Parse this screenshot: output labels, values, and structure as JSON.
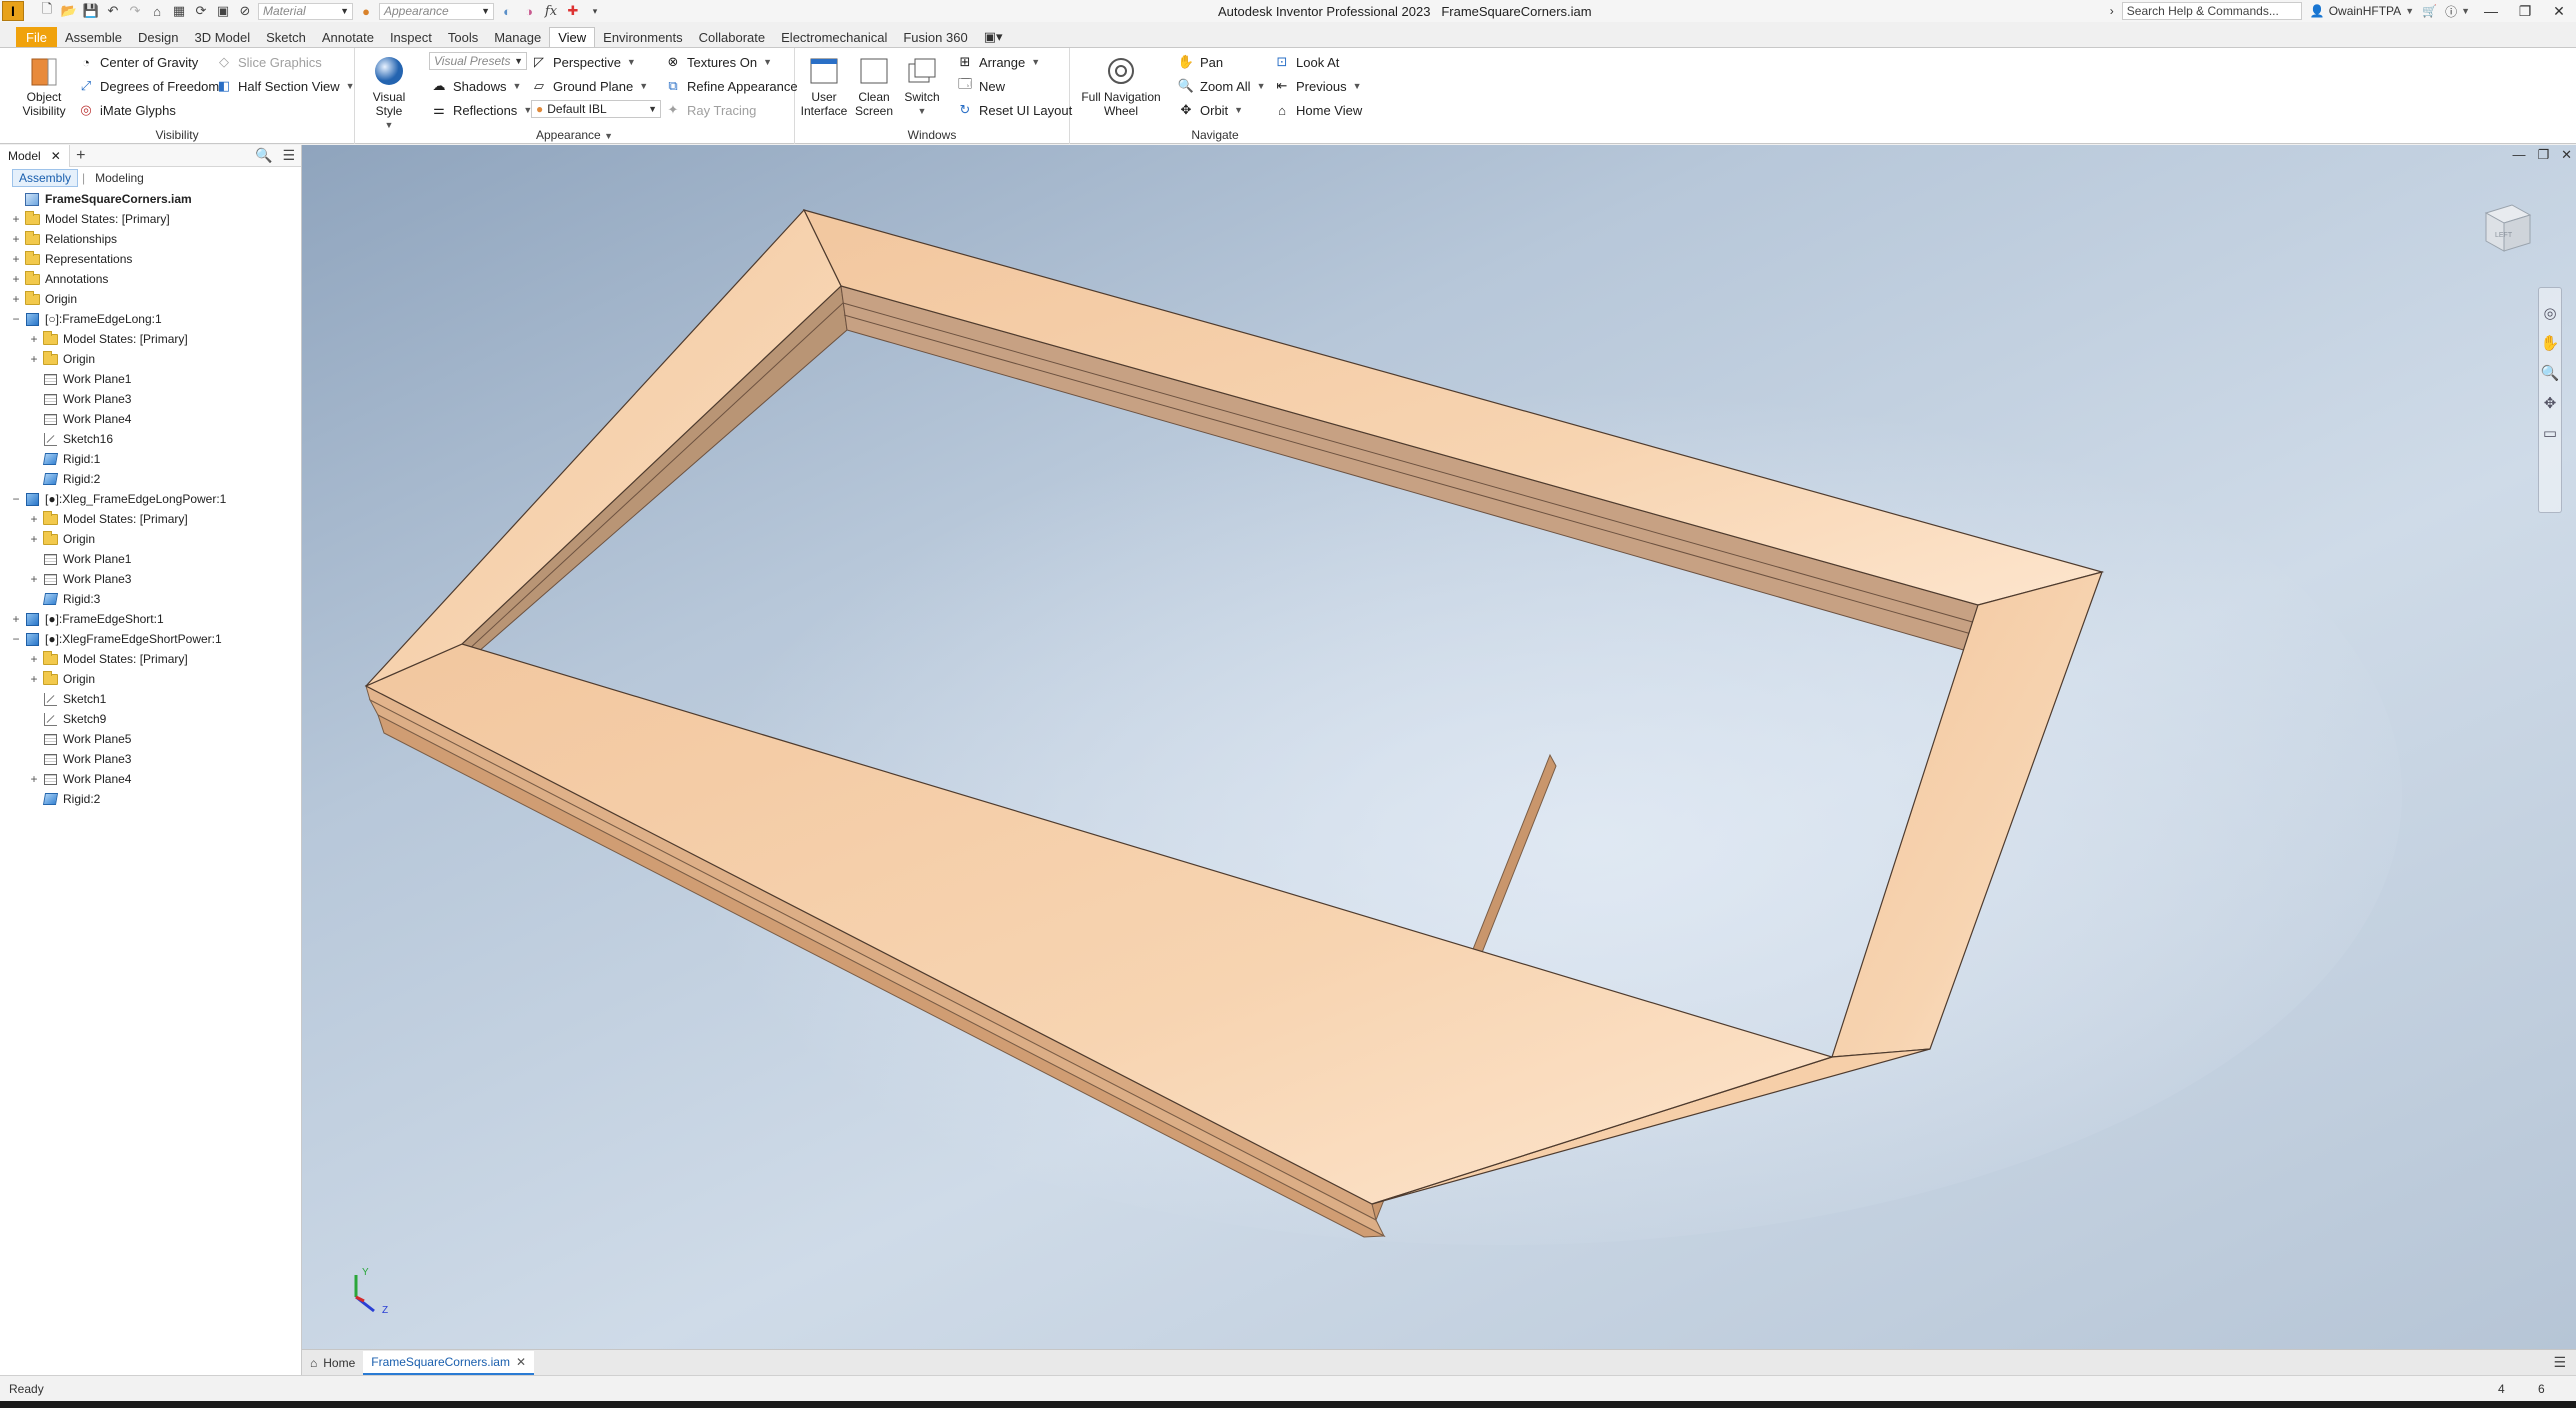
{
  "window": {
    "app_title": "Autodesk Inventor Professional 2023",
    "file_name": "FrameSquareCorners.iam",
    "logo_letter": "I"
  },
  "quick_access": {
    "material_placeholder": "Material",
    "appearance_placeholder": "Appearance",
    "fx_label": "fx"
  },
  "title_right": {
    "search_placeholder": "Search Help & Commands...",
    "user_name": "OwainHFTPA"
  },
  "menu_tabs": [
    "File",
    "Assemble",
    "Design",
    "3D Model",
    "Sketch",
    "Annotate",
    "Inspect",
    "Tools",
    "Manage",
    "View",
    "Environments",
    "Collaborate",
    "Electromechanical",
    "Fusion 360"
  ],
  "active_tab": "View",
  "ribbon": {
    "visibility": {
      "title": "Visibility",
      "object_visibility": "Object\nVisibility",
      "center_of_gravity": "Center of Gravity",
      "degrees_of_freedom": "Degrees of Freedom",
      "imate_glyphs": "iMate Glyphs",
      "slice_graphics": "Slice Graphics",
      "half_section_view": "Half Section View"
    },
    "appearance": {
      "title": "Appearance",
      "visual_style": "Visual Style",
      "visual_presets": "Visual Presets",
      "shadows": "Shadows",
      "reflections": "Reflections",
      "perspective": "Perspective",
      "ground_plane": "Ground Plane",
      "ibl_value": "Default IBL",
      "textures_on": "Textures On",
      "refine_appearance": "Refine Appearance",
      "ray_tracing": "Ray Tracing"
    },
    "windows": {
      "title": "Windows",
      "user_interface": "User\nInterface",
      "clean_screen": "Clean\nScreen",
      "switch": "Switch",
      "arrange": "Arrange",
      "new": "New",
      "reset_ui_layout": "Reset UI Layout"
    },
    "navigate": {
      "title": "Navigate",
      "full_navigation_wheel": "Full Navigation\nWheel",
      "pan": "Pan",
      "zoom_all": "Zoom All",
      "orbit": "Orbit",
      "look_at": "Look At",
      "previous": "Previous",
      "home_view": "Home View"
    }
  },
  "browser": {
    "tab_label": "Model",
    "subtabs": [
      "Assembly",
      "Modeling"
    ],
    "tree": [
      {
        "label": "FrameSquareCorners.iam",
        "level": 0,
        "icon": "assembly",
        "exp": "",
        "bold": true
      },
      {
        "label": "Model States: [Primary]",
        "level": 0,
        "icon": "folder",
        "exp": "+"
      },
      {
        "label": "Relationships",
        "level": 0,
        "icon": "folder",
        "exp": "+"
      },
      {
        "label": "Representations",
        "level": 0,
        "icon": "folder",
        "exp": "+"
      },
      {
        "label": "Annotations",
        "level": 0,
        "icon": "folder",
        "exp": "+"
      },
      {
        "label": "Origin",
        "level": 0,
        "icon": "folder",
        "exp": "+"
      },
      {
        "label": "[○]:FrameEdgeLong:1",
        "level": 0,
        "icon": "part",
        "exp": "−"
      },
      {
        "label": "Model States: [Primary]",
        "level": 1,
        "icon": "folder",
        "exp": "+"
      },
      {
        "label": "Origin",
        "level": 1,
        "icon": "folder",
        "exp": "+"
      },
      {
        "label": "Work Plane1",
        "level": 1,
        "icon": "workplane",
        "exp": ""
      },
      {
        "label": "Work Plane3",
        "level": 1,
        "icon": "workplane",
        "exp": ""
      },
      {
        "label": "Work Plane4",
        "level": 1,
        "icon": "workplane",
        "exp": ""
      },
      {
        "label": "Sketch16",
        "level": 1,
        "icon": "sketch",
        "exp": ""
      },
      {
        "label": "Rigid:1",
        "level": 1,
        "icon": "rigid",
        "exp": ""
      },
      {
        "label": "Rigid:2",
        "level": 1,
        "icon": "rigid",
        "exp": ""
      },
      {
        "label": "[●]:Xleg_FrameEdgeLongPower:1",
        "level": 0,
        "icon": "part",
        "exp": "−"
      },
      {
        "label": "Model States: [Primary]",
        "level": 1,
        "icon": "folder",
        "exp": "+"
      },
      {
        "label": "Origin",
        "level": 1,
        "icon": "folder",
        "exp": "+"
      },
      {
        "label": "Work Plane1",
        "level": 1,
        "icon": "workplane",
        "exp": ""
      },
      {
        "label": "Work Plane3",
        "level": 1,
        "icon": "workplane",
        "exp": "+"
      },
      {
        "label": "Rigid:3",
        "level": 1,
        "icon": "rigid",
        "exp": ""
      },
      {
        "label": "[●]:FrameEdgeShort:1",
        "level": 0,
        "icon": "part",
        "exp": "+"
      },
      {
        "label": "[●]:XlegFrameEdgeShortPower:1",
        "level": 0,
        "icon": "part",
        "exp": "−"
      },
      {
        "label": "Model States: [Primary]",
        "level": 1,
        "icon": "folder",
        "exp": "+"
      },
      {
        "label": "Origin",
        "level": 1,
        "icon": "folder",
        "exp": "+"
      },
      {
        "label": "Sketch1",
        "level": 1,
        "icon": "sketch",
        "exp": ""
      },
      {
        "label": "Sketch9",
        "level": 1,
        "icon": "sketch",
        "exp": ""
      },
      {
        "label": "Work Plane5",
        "level": 1,
        "icon": "workplane",
        "exp": ""
      },
      {
        "label": "Work Plane3",
        "level": 1,
        "icon": "workplane",
        "exp": ""
      },
      {
        "label": "Work Plane4",
        "level": 1,
        "icon": "workplane",
        "exp": "+"
      },
      {
        "label": "Rigid:2",
        "level": 1,
        "icon": "rigid",
        "exp": ""
      }
    ]
  },
  "viewport": {
    "viewcube_face": "LEFT",
    "triad_y": "Y",
    "triad_z": "Z",
    "frame_color": "#f5cfa8"
  },
  "doc_tabs": {
    "home": "Home",
    "active_doc": "FrameSquareCorners.iam"
  },
  "status": {
    "text": "Ready",
    "count_a": "4",
    "count_b": "6"
  }
}
